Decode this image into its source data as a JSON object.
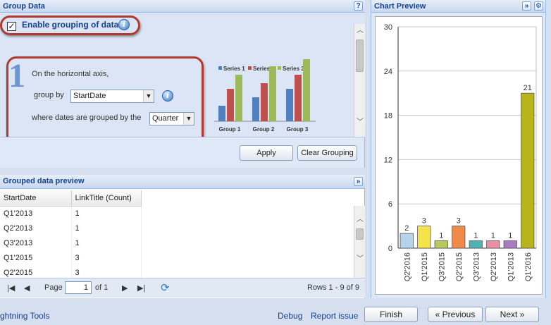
{
  "group_data": {
    "title": "Group Data",
    "help_label": "?",
    "enable_label": "Enable grouping of data",
    "enable_checked": true,
    "step_number": "1",
    "horizontal_axis_text": "On the horizontal axis,",
    "group_by_label": "group by",
    "group_by_value": "StartDate",
    "dates_grouped_label": "where dates are grouped by the",
    "dates_grouped_value": "Quarter",
    "illustration": {
      "legend": [
        "Series 1",
        "Series 2",
        "Series 3"
      ],
      "groups": [
        "Group 1",
        "Group 2",
        "Group 3"
      ],
      "colors": [
        "#4f81bd",
        "#c0504d",
        "#9bbb59"
      ]
    },
    "apply_label": "Apply",
    "clear_label": "Clear Grouping"
  },
  "grouped_preview": {
    "title": "Grouped data preview",
    "columns": [
      "StartDate",
      "LinkTitle (Count)"
    ],
    "rows": [
      [
        "Q1'2013",
        "1"
      ],
      [
        "Q2'2013",
        "1"
      ],
      [
        "Q3'2013",
        "1"
      ],
      [
        "Q1'2015",
        "3"
      ],
      [
        "Q2'2015",
        "3"
      ]
    ],
    "pager": {
      "page_label": "Page",
      "page_value": "1",
      "of_label": "of 1",
      "rows_label": "Rows 1 - 9 of 9"
    }
  },
  "chart_preview": {
    "title": "Chart Preview"
  },
  "chart_data": {
    "type": "bar",
    "categories": [
      "Q2'2016",
      "Q1'2015",
      "Q3'2015",
      "Q2'2015",
      "Q3'2013",
      "Q2'2013",
      "Q1'2013",
      "Q1'2016"
    ],
    "values": [
      2,
      3,
      1,
      3,
      1,
      1,
      1,
      21
    ],
    "colors": [
      "#b6d3ee",
      "#f5e34a",
      "#b7c95a",
      "#f08a4b",
      "#4fb3b3",
      "#e88fa4",
      "#a97bc0",
      "#b8b41c"
    ],
    "yticks": [
      0,
      6,
      12,
      18,
      24,
      30
    ],
    "ylim": [
      0,
      30
    ],
    "grid": true
  },
  "footer": {
    "brand_text": "ghtning Tools",
    "debug_label": "Debug",
    "report_label": "Report issue",
    "finish_label": "Finish",
    "previous_label": "« Previous",
    "next_label": "Next »"
  }
}
